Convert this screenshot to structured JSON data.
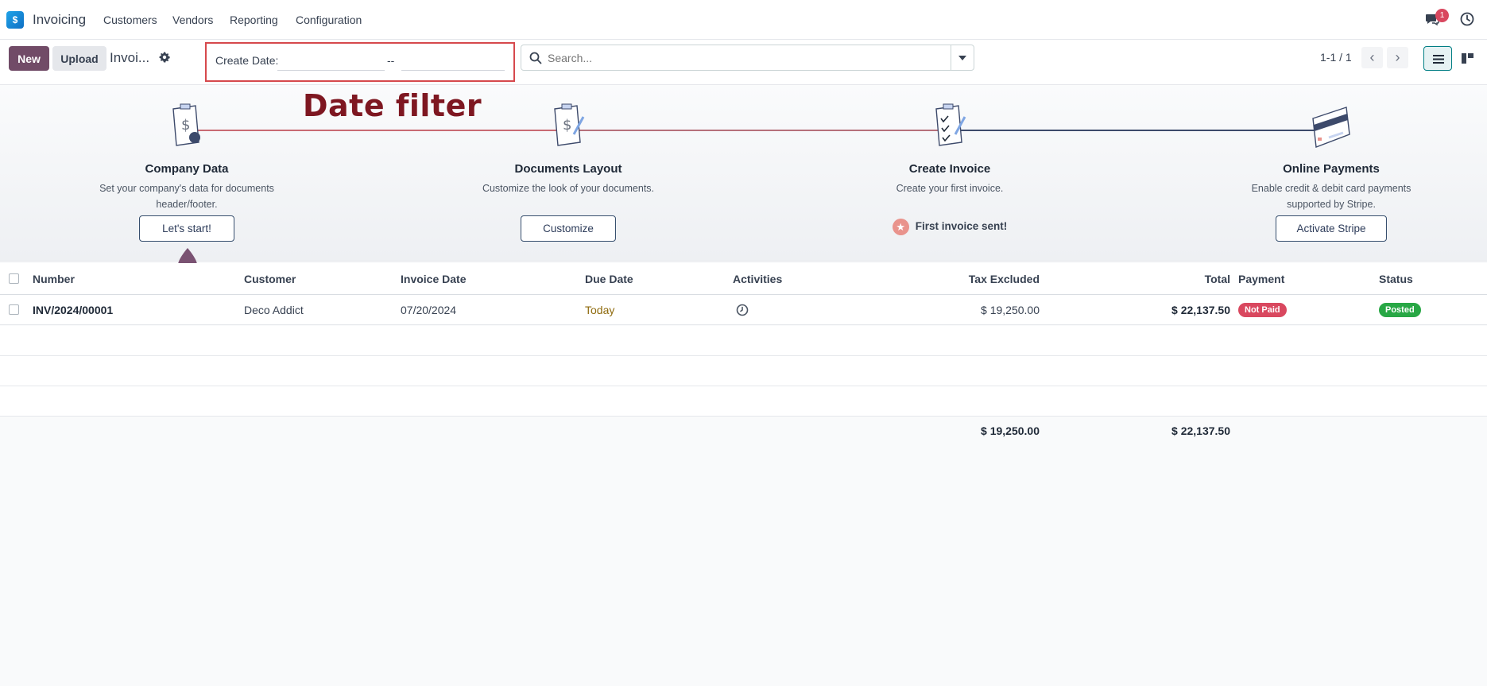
{
  "app": {
    "name": "Invoicing"
  },
  "nav": {
    "menu": [
      "Customers",
      "Vendors",
      "Reporting",
      "Configuration"
    ],
    "chat_badge": "1"
  },
  "controls": {
    "new_label": "New",
    "upload_label": "Upload",
    "breadcrumb": "Invoi...",
    "date_filter": {
      "label": "Create Date:",
      "from": "",
      "separator": "--",
      "to": ""
    },
    "search_placeholder": "Search...",
    "pager": "1-1 / 1"
  },
  "annotation": "Date filter",
  "onboarding": {
    "steps": [
      {
        "title": "Company Data",
        "desc": "Set your company's data for documents header/footer.",
        "button": "Let's start!"
      },
      {
        "title": "Documents Layout",
        "desc": "Customize the look of your documents.",
        "button": "Customize"
      },
      {
        "title": "Create Invoice",
        "desc": "Create your first invoice.",
        "done_text": "First invoice sent!"
      },
      {
        "title": "Online Payments",
        "desc": "Enable credit & debit card payments supported by Stripe.",
        "button": "Activate Stripe"
      }
    ]
  },
  "table": {
    "columns": [
      "Number",
      "Customer",
      "Invoice Date",
      "Due Date",
      "Activities",
      "Tax Excluded",
      "Total",
      "Payment",
      "Status"
    ],
    "rows": [
      {
        "number": "INV/2024/00001",
        "customer": "Deco Addict",
        "invoice_date": "07/20/2024",
        "due_date": "Today",
        "tax_excluded": "$ 19,250.00",
        "total": "$ 22,137.50",
        "payment": "Not Paid",
        "status": "Posted"
      }
    ],
    "totals": {
      "tax_excluded": "$ 19,250.00",
      "total": "$ 22,137.50"
    }
  },
  "colors": {
    "brand": "#714b67",
    "annotation_red": "#7e1721",
    "not_paid": "#d9485f",
    "posted": "#28a745",
    "due_today": "#8f6b0e"
  }
}
